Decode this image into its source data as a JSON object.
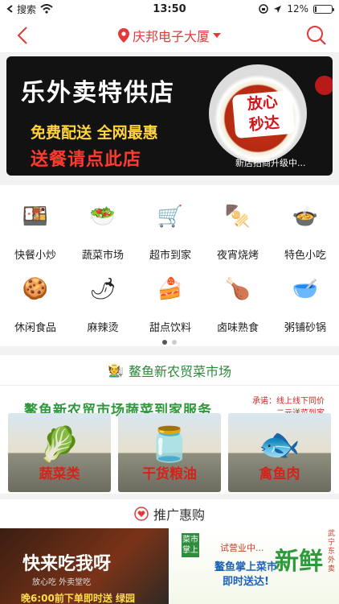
{
  "status_bar": {
    "carrier": "搜索",
    "time": "13:50",
    "battery_percent": "12%",
    "battery_level": 0.12
  },
  "header": {
    "location": "庆邦电子大厦"
  },
  "banner": {
    "title": "乐外卖特供店",
    "line1": "免费配送  全网最惠",
    "line2": "送餐请点此店",
    "stamp_line1": "放心",
    "stamp_line2": "秒达",
    "promo": "新店招商升级中..."
  },
  "categories": [
    {
      "label": "快餐小炒",
      "icon": "fast-food-icon",
      "glyph": "🍱"
    },
    {
      "label": "蔬菜市场",
      "icon": "vegetable-icon",
      "glyph": "🥗"
    },
    {
      "label": "超市到家",
      "icon": "supermarket-icon",
      "glyph": "🛒"
    },
    {
      "label": "夜宵烧烤",
      "icon": "bbq-icon",
      "glyph": "🍢"
    },
    {
      "label": "特色小吃",
      "icon": "snack-icon",
      "glyph": "🍲"
    },
    {
      "label": "休闲食品",
      "icon": "leisure-food-icon",
      "glyph": "🍪"
    },
    {
      "label": "麻辣烫",
      "icon": "spicy-hotpot-icon",
      "glyph": "🌶"
    },
    {
      "label": "甜点饮料",
      "icon": "dessert-icon",
      "glyph": "🍰"
    },
    {
      "label": "卤味熟食",
      "icon": "braised-food-icon",
      "glyph": "🍗"
    },
    {
      "label": "粥铺砂锅",
      "icon": "porridge-icon",
      "glyph": "🥣"
    }
  ],
  "pager": {
    "count": 2,
    "active": 0
  },
  "market": {
    "title": "鳌鱼新农贸菜市场",
    "banner_head": "鳌鱼新农贸市场蔬菜到家服务",
    "note_line1": "承诺：线上线下同价",
    "note_line2": "二元送菜到家",
    "tiles": [
      {
        "label": "蔬菜类",
        "glyph": "🥬"
      },
      {
        "label": "干货粮油",
        "glyph": "🫙"
      },
      {
        "label": "禽鱼肉",
        "glyph": "🐟"
      }
    ]
  },
  "recommend": {
    "title": "推广惠购",
    "left": {
      "line1": "快来吃我呀",
      "line2": "放心吃  外卖堂吃",
      "line3": "晚6:00前下单即时送  绿园"
    },
    "right": {
      "tag": "菜市掌上",
      "notice": "试营业中...",
      "line1": "鳌鱼掌上菜市",
      "line2": "即时送达!",
      "big": "新鲜",
      "sub": "武宁东外卖"
    }
  },
  "colors": {
    "accent": "#e23a3a",
    "market_green": "#2a8a3a"
  }
}
